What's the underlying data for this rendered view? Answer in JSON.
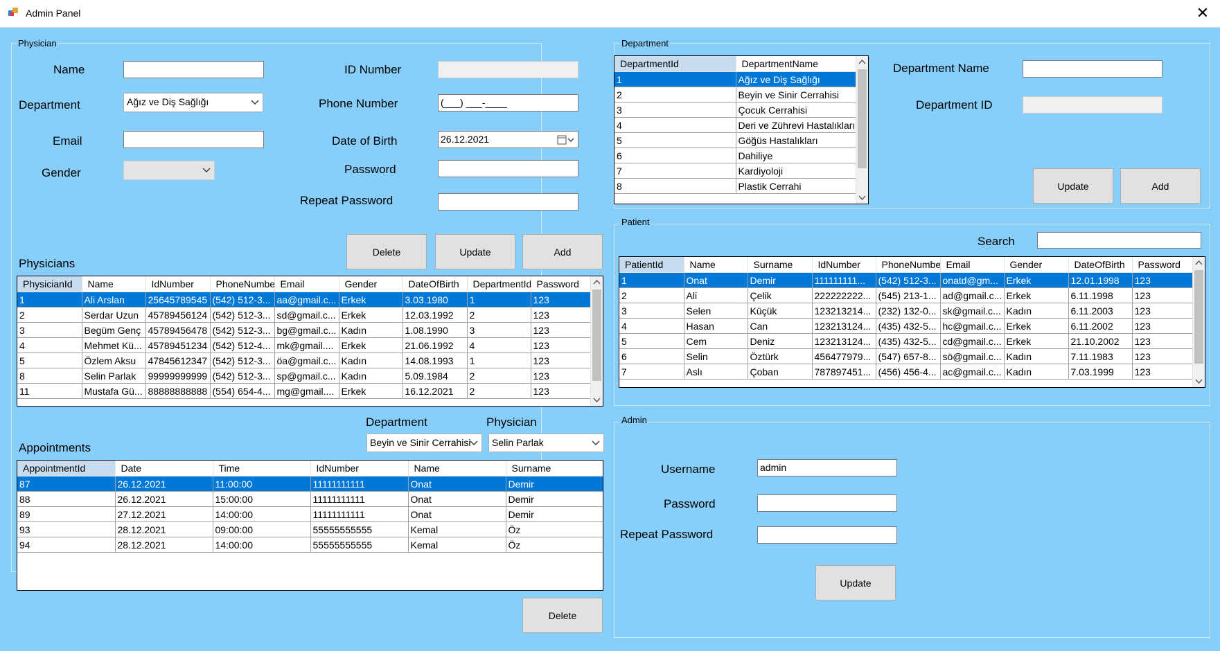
{
  "window": {
    "title": "Admin Panel",
    "close_glyph": "✕"
  },
  "physician_group": {
    "legend": "Physician",
    "name_label": "Name",
    "name_value": "",
    "department_label": "Department",
    "department_value": "Ağız ve Diş Sağlığı",
    "email_label": "Email",
    "email_value": "",
    "gender_label": "Gender",
    "gender_value": "",
    "id_number_label": "ID Number",
    "id_number_value": "",
    "phone_label": "Phone Number",
    "phone_value": "(___) ___-____",
    "dob_label": "Date of Birth",
    "dob_value": "26.12.2021",
    "password_label": "Password",
    "password_value": "",
    "repeat_password_label": "Repeat Password",
    "repeat_password_value": "",
    "delete_label": "Delete",
    "update_label": "Update",
    "add_label": "Add",
    "physicians_label": "Physicians"
  },
  "physicians_grid": {
    "columns": [
      "PhysicianId",
      "Name",
      "IdNumber",
      "PhoneNumbe",
      "Email",
      "Gender",
      "DateOfBirth",
      "DepartmentId",
      "Password"
    ],
    "rows": [
      [
        "1",
        "Ali Arslan",
        "25645789545",
        "(542) 512-3...",
        "aa@gmail.c...",
        "Erkek",
        "3.03.1980",
        "1",
        "123"
      ],
      [
        "2",
        "Serdar Uzun",
        "45789456124",
        "(542) 512-3...",
        "sd@gmail.c...",
        "Erkek",
        "12.03.1992",
        "2",
        "123"
      ],
      [
        "3",
        "Begüm Genç",
        "45789456478",
        "(542) 512-3...",
        "bg@gmail.c...",
        "Kadın",
        "1.08.1990",
        "3",
        "123"
      ],
      [
        "4",
        "Mehmet Kü...",
        "45789451234",
        "(542) 512-4...",
        "mk@gmail....",
        "Erkek",
        "21.06.1992",
        "4",
        "123"
      ],
      [
        "5",
        "Özlem Aksu",
        "47845612347",
        "(542) 512-3...",
        "öa@gmail.c...",
        "Kadın",
        "14.08.1993",
        "1",
        "123"
      ],
      [
        "8",
        "Selin Parlak",
        "99999999999",
        "(542) 512-3...",
        "sp@gmail.c...",
        "Kadın",
        "5.09.1984",
        "2",
        "123"
      ],
      [
        "11",
        "Mustafa Gü...",
        "88888888888",
        "(554) 654-4...",
        "mg@gmail....",
        "Erkek",
        "16.12.2021",
        "2",
        "123"
      ]
    ]
  },
  "appointments": {
    "label": "Appointments",
    "department_label": "Department",
    "department_value": "Beyin ve Sinir Cerrahisi",
    "physician_label": "Physician",
    "physician_value": "Selin Parlak",
    "columns": [
      "AppointmentId",
      "Date",
      "Time",
      "IdNumber",
      "Name",
      "Surname"
    ],
    "rows": [
      [
        "87",
        "26.12.2021",
        "11:00:00",
        "11111111111",
        "Onat",
        "Demir"
      ],
      [
        "88",
        "26.12.2021",
        "15:00:00",
        "11111111111",
        "Onat",
        "Demir"
      ],
      [
        "89",
        "27.12.2021",
        "14:00:00",
        "11111111111",
        "Onat",
        "Demir"
      ],
      [
        "93",
        "28.12.2021",
        "09:00:00",
        "55555555555",
        "Kemal",
        "Öz"
      ],
      [
        "94",
        "28.12.2021",
        "14:00:00",
        "55555555555",
        "Kemal",
        "Öz"
      ]
    ],
    "delete_label": "Delete"
  },
  "department_group": {
    "legend": "Department",
    "columns": [
      "DepartmentId",
      "DepartmentName"
    ],
    "rows": [
      [
        "1",
        "Ağız ve Diş Sağlığı"
      ],
      [
        "2",
        "Beyin ve Sinir Cerrahisi"
      ],
      [
        "3",
        "Çocuk Cerrahisi"
      ],
      [
        "4",
        "Deri ve Zührevi Hastalıkları"
      ],
      [
        "5",
        "Göğüs Hastalıkları"
      ],
      [
        "6",
        "Dahiliye"
      ],
      [
        "7",
        "Kardiyoloji"
      ],
      [
        "8",
        "Plastik Cerrahi"
      ]
    ],
    "name_label": "Department Name",
    "name_value": "",
    "id_label": "Department ID",
    "id_value": "",
    "update_label": "Update",
    "add_label": "Add"
  },
  "patient_group": {
    "legend": "Patient",
    "search_label": "Search",
    "search_value": "",
    "columns": [
      "PatientId",
      "Name",
      "Surname",
      "IdNumber",
      "PhoneNumbe",
      "Email",
      "Gender",
      "DateOfBirth",
      "Password"
    ],
    "rows": [
      [
        "1",
        "Onat",
        "Demir",
        "111111111...",
        "(542) 512-3...",
        "onatd@gm...",
        "Erkek",
        "12.01.1998",
        "123"
      ],
      [
        "2",
        "Ali",
        "Çelik",
        "222222222...",
        "(545) 213-1...",
        "ad@gmail.c...",
        "Erkek",
        "6.11.1998",
        "123"
      ],
      [
        "3",
        "Selen",
        "Küçük",
        "123213214...",
        "(232) 132-0...",
        "sk@gmail.c...",
        "Kadın",
        "6.11.2003",
        "123"
      ],
      [
        "4",
        "Hasan",
        "Can",
        "123213124...",
        "(435) 432-5...",
        "hc@gmail.c...",
        "Erkek",
        "6.11.2002",
        "123"
      ],
      [
        "5",
        "Cem",
        "Deniz",
        "123213124...",
        "(435) 432-5...",
        "cd@gmail.c...",
        "Erkek",
        "21.10.2002",
        "123"
      ],
      [
        "6",
        "Selin",
        "Öztürk",
        "456477979...",
        "(547) 657-8...",
        "sö@gmail.c...",
        "Kadın",
        "7.11.1983",
        "123"
      ],
      [
        "7",
        "Aslı",
        "Çoban",
        "787897451...",
        "(456) 456-4...",
        "ac@gmail.c...",
        "Kadın",
        "7.03.1999",
        "123"
      ]
    ]
  },
  "admin_group": {
    "legend": "Admin",
    "username_label": "Username",
    "username_value": "admin",
    "password_label": "Password",
    "password_value": "",
    "repeat_password_label": "Repeat Password",
    "repeat_password_value": "",
    "update_label": "Update"
  },
  "colors": {
    "background": "#87cefa",
    "selection": "#0078d7",
    "button": "#e1e1e1"
  },
  "icons": {
    "app": "app-icon",
    "close": "close-icon",
    "dropdown": "chevron-down-icon",
    "calendar": "calendar-icon"
  }
}
